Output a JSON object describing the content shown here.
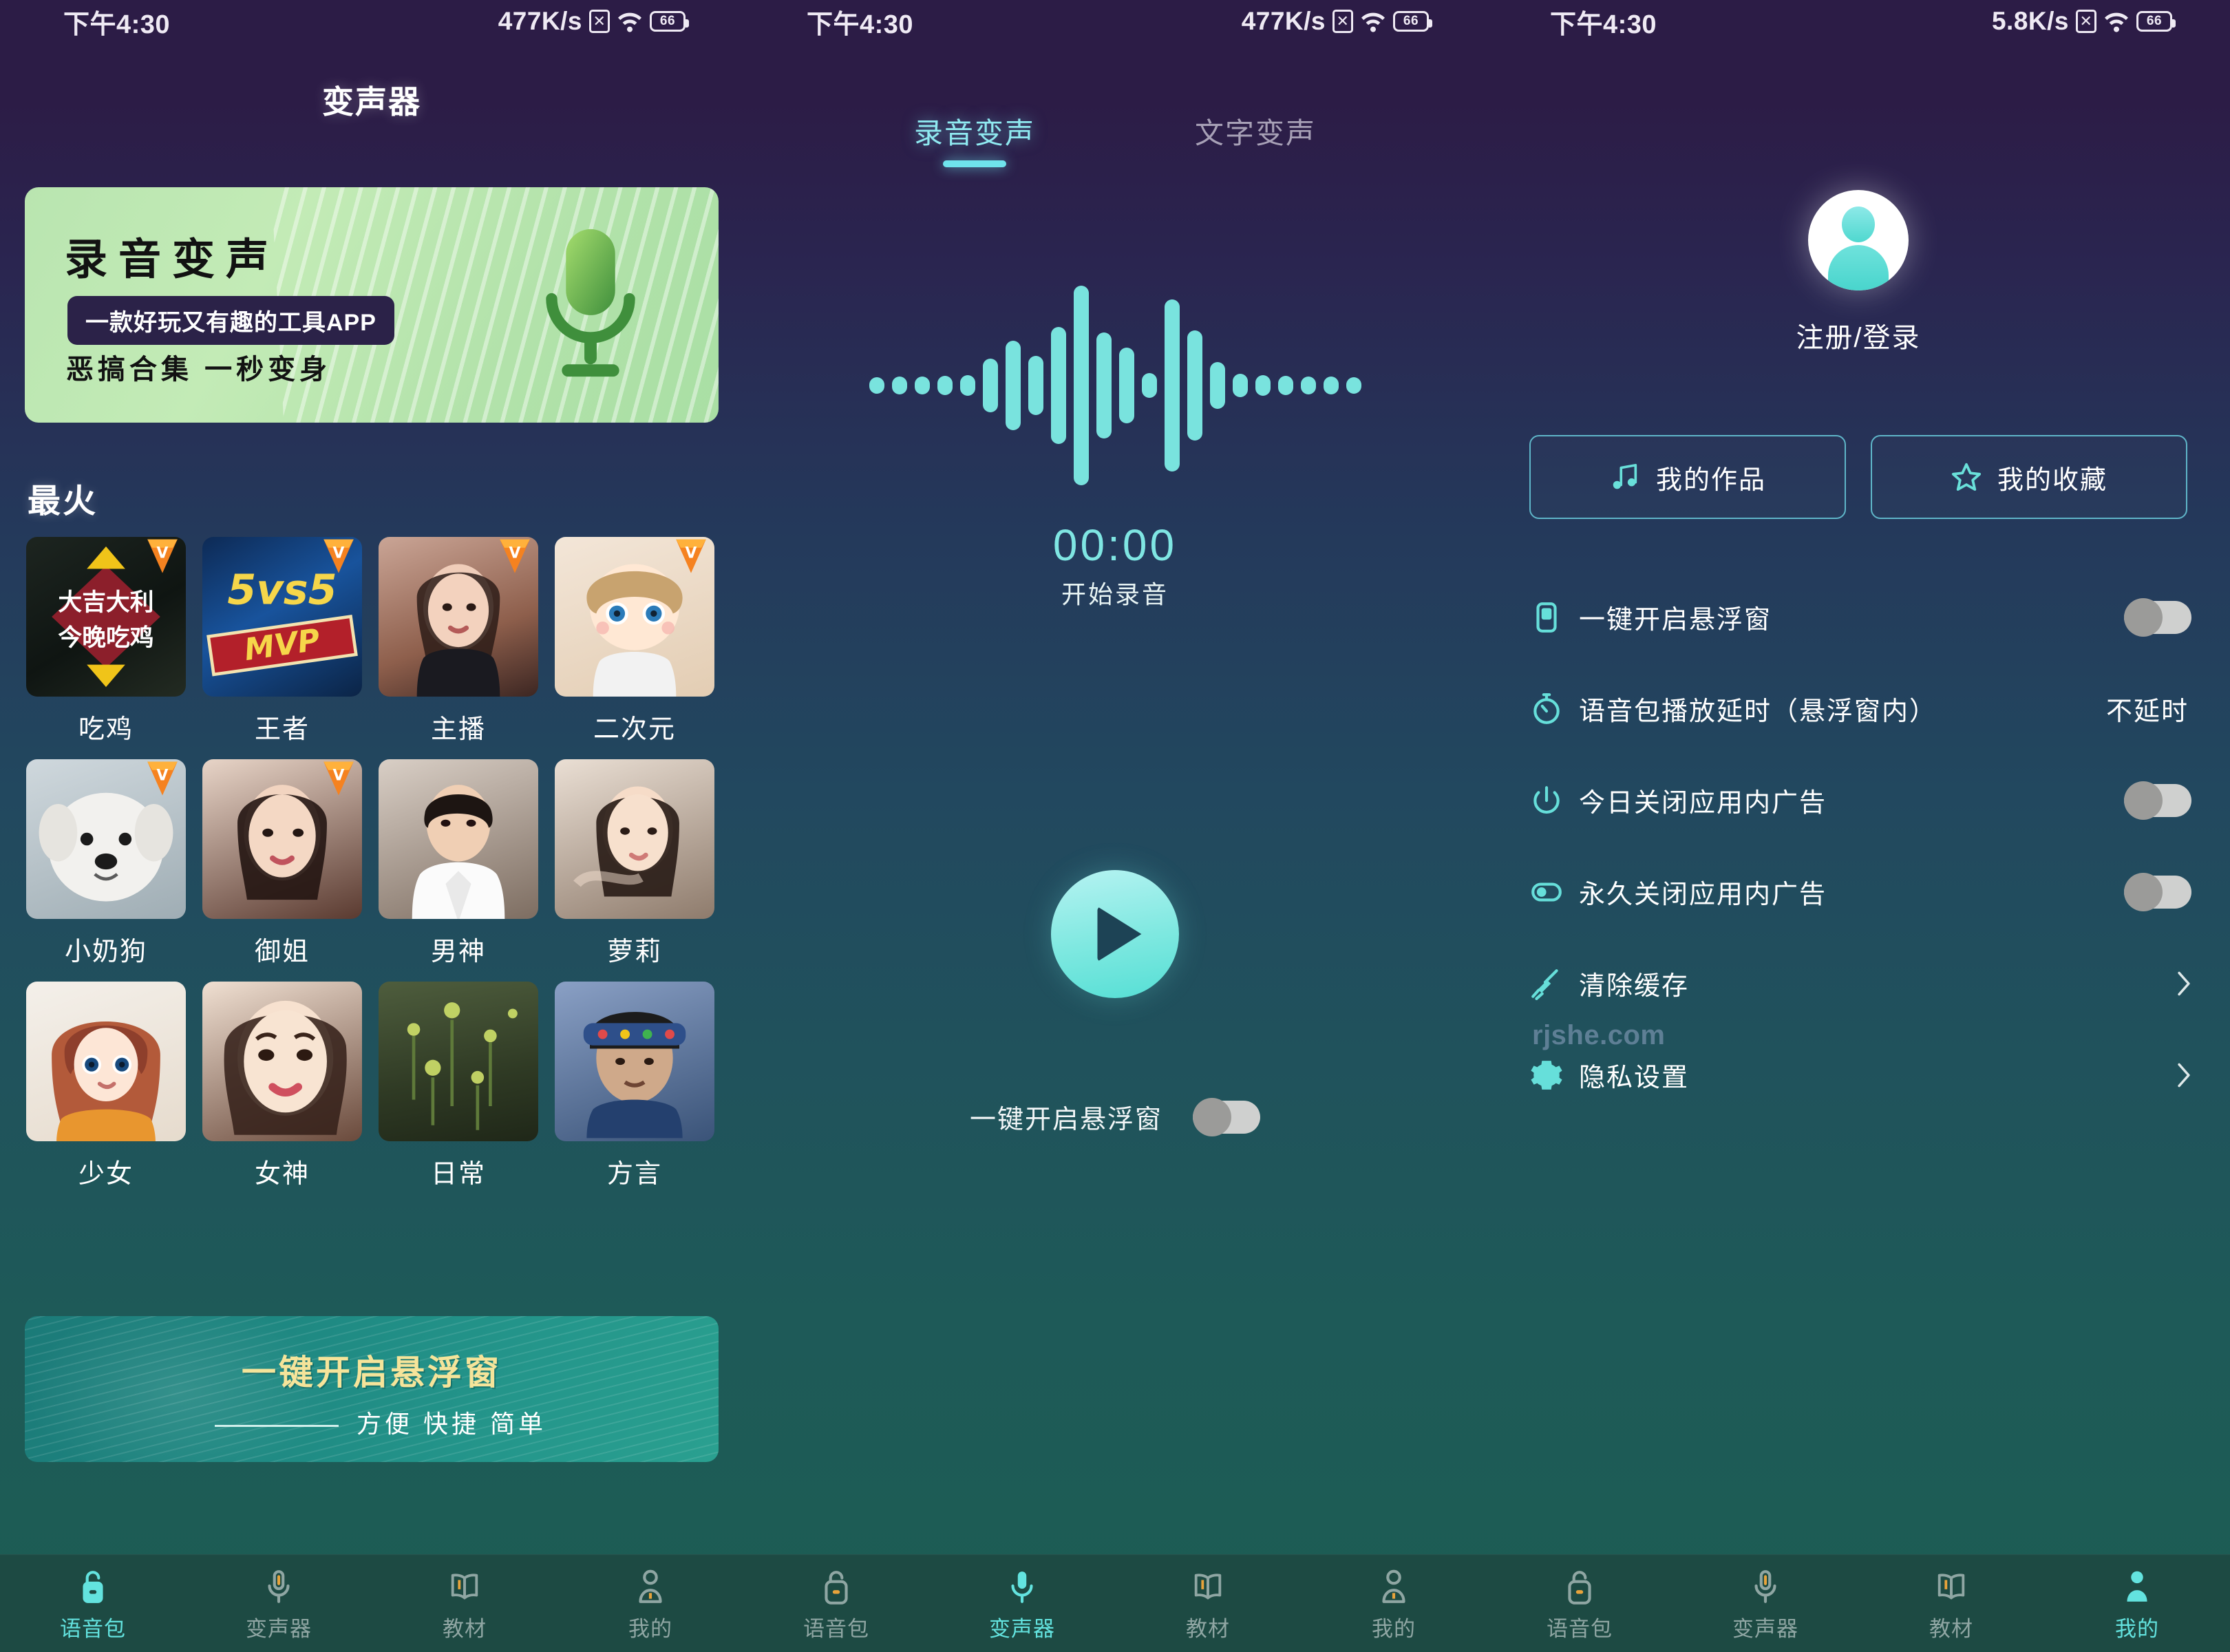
{
  "status_bar": [
    {
      "time": "下午4:30",
      "speed": "477K/s",
      "battery": "66"
    },
    {
      "time": "下午4:30",
      "speed": "477K/s",
      "battery": "66"
    },
    {
      "time": "下午4:30",
      "speed": "5.8K/s",
      "battery": "66"
    }
  ],
  "panel1": {
    "title": "变声器",
    "green_banner": {
      "heading": "录音变声",
      "pill": "一款好玩又有趣的工具APP",
      "subtitle": "恶搞合集  一秒变身",
      "icon": "microphone-icon"
    },
    "section_title": "最火",
    "grid": [
      {
        "label": "吃鸡",
        "badge": "vip-diamond-badge",
        "has_badge": true
      },
      {
        "label": "王者",
        "badge": "vip-diamond-badge",
        "has_badge": true
      },
      {
        "label": "主播",
        "badge": "vip-diamond-badge",
        "has_badge": true
      },
      {
        "label": "二次元",
        "badge": "vip-diamond-badge",
        "has_badge": true
      },
      {
        "label": "小奶狗",
        "badge": "vip-diamond-badge",
        "has_badge": true
      },
      {
        "label": "御姐",
        "badge": "vip-diamond-badge",
        "has_badge": true
      },
      {
        "label": "男神",
        "badge": "",
        "has_badge": false
      },
      {
        "label": "萝莉",
        "badge": "",
        "has_badge": false
      },
      {
        "label": "少女",
        "badge": "",
        "has_badge": false
      },
      {
        "label": "女神",
        "badge": "",
        "has_badge": false
      },
      {
        "label": "日常",
        "badge": "",
        "has_badge": false
      },
      {
        "label": "方言",
        "badge": "",
        "has_badge": false
      }
    ],
    "teal_banner": {
      "heading": "一键开启悬浮窗",
      "subtitle": "方便 快捷 简单"
    }
  },
  "panel2": {
    "tabs": [
      {
        "label": "录音变声",
        "active": true
      },
      {
        "label": "文字变声",
        "active": false
      }
    ],
    "timer": "00:00",
    "record_hint": "开始录音",
    "play_button": "play-icon",
    "float_toggle": {
      "label": "一键开启悬浮窗",
      "on": false
    }
  },
  "panel3": {
    "avatar": "user-avatar-icon",
    "login_label": "注册/登录",
    "quick_buttons": [
      {
        "label": "我的作品",
        "icon": "music-note-icon"
      },
      {
        "label": "我的收藏",
        "icon": "star-icon"
      }
    ],
    "settings": [
      {
        "label": "一键开启悬浮窗",
        "icon": "floating-window-icon",
        "type": "toggle",
        "on": false
      },
      {
        "label": "语音包播放延时（悬浮窗内）",
        "icon": "stopwatch-icon",
        "type": "value",
        "value": "不延时"
      },
      {
        "label": "今日关闭应用内广告",
        "icon": "power-icon",
        "type": "toggle",
        "on": false
      },
      {
        "label": "永久关闭应用内广告",
        "icon": "switch-icon",
        "type": "toggle",
        "on": false
      },
      {
        "label": "清除缓存",
        "icon": "broom-icon",
        "type": "link"
      },
      {
        "label": "隐私设置",
        "icon": "gear-icon",
        "type": "link"
      }
    ],
    "watermark": "rjshe.com"
  },
  "nav_groups": [
    {
      "items": [
        {
          "label": "语音包",
          "icon": "voice-pack-icon",
          "active": true
        },
        {
          "label": "变声器",
          "icon": "microphone-icon",
          "active": false
        },
        {
          "label": "教材",
          "icon": "book-icon",
          "active": false
        },
        {
          "label": "我的",
          "icon": "person-icon",
          "active": false
        }
      ]
    },
    {
      "items": [
        {
          "label": "语音包",
          "icon": "voice-pack-icon",
          "active": false
        },
        {
          "label": "变声器",
          "icon": "microphone-icon",
          "active": true
        },
        {
          "label": "教材",
          "icon": "book-icon",
          "active": false
        },
        {
          "label": "我的",
          "icon": "person-icon",
          "active": false
        }
      ]
    },
    {
      "items": [
        {
          "label": "语音包",
          "icon": "voice-pack-icon",
          "active": false
        },
        {
          "label": "变声器",
          "icon": "microphone-icon",
          "active": false
        },
        {
          "label": "教材",
          "icon": "book-icon",
          "active": false
        },
        {
          "label": "我的",
          "icon": "person-icon",
          "active": true
        }
      ]
    }
  ],
  "colors": {
    "accent_teal": "#6fe3ec",
    "banner_green": "#b9e5b0",
    "banner_teal": "#1f8a83",
    "nav_bg": "#1d4a43",
    "badge_orange": "#f07b14",
    "header_purple": "#2c1c46"
  }
}
